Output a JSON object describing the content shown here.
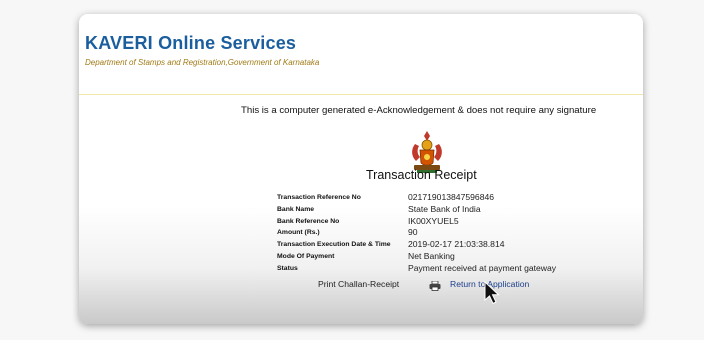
{
  "header": {
    "title": "KAVERI Online Services",
    "subtitle": "Department of Stamps and Registration,Government of Karnataka"
  },
  "notice": "This is a computer generated e-Acknowledgement & does not require any signature",
  "emblem_icon": "karnataka-emblem",
  "receipt": {
    "title": "Transaction Receipt",
    "rows": [
      {
        "label": "Transaction Reference No",
        "value": "021719013847596846"
      },
      {
        "label": "Bank Name",
        "value": "State Bank of India"
      },
      {
        "label": "Bank Reference No",
        "value": "IK00XYUEL5"
      },
      {
        "label": "Amount (Rs.)",
        "value": "90"
      },
      {
        "label": "Transaction Execution Date & Time",
        "value": "2019-02-17 21:03:38.814"
      },
      {
        "label": "Mode Of Payment",
        "value": "Net Banking"
      },
      {
        "label": "Status",
        "value": "Payment received at payment gateway"
      }
    ]
  },
  "actions": {
    "print_label": "Print Challan-Receipt",
    "print_icon": "printer-icon",
    "return_label": "Return to Application"
  },
  "colors": {
    "title": "#1b5e9e",
    "subtitle": "#a07a14",
    "link": "#1b3f8a"
  }
}
